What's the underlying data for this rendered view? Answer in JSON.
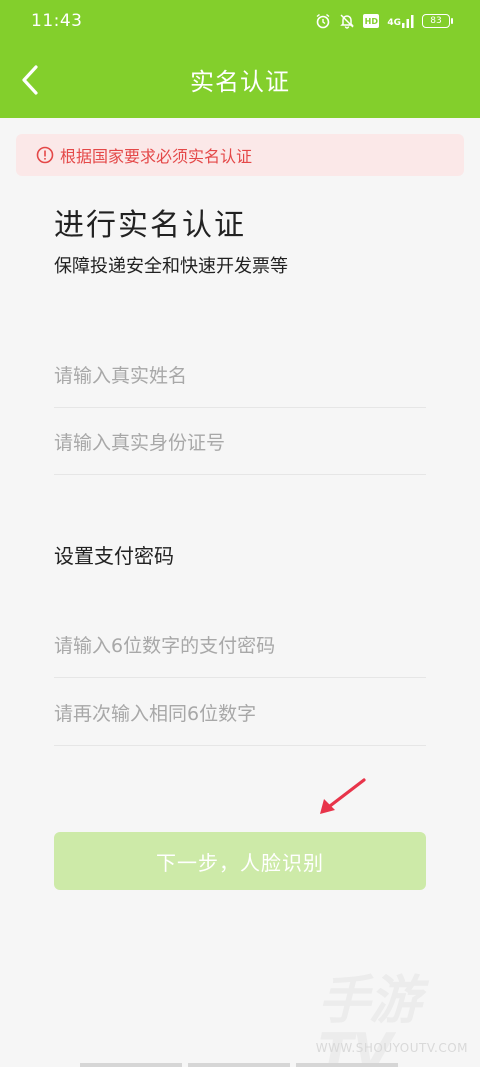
{
  "status_bar": {
    "time": "11:43",
    "hd_label": "HD",
    "network_label": "4G",
    "battery_level": "83"
  },
  "header": {
    "title": "实名认证",
    "background_color": "#83cf2c"
  },
  "notice": {
    "text": "根据国家要求必须实名认证",
    "color": "#e44848"
  },
  "content": {
    "title": "进行实名认证",
    "subtitle": "保障投递安全和快速开发票等"
  },
  "form": {
    "name_placeholder": "请输入真实姓名",
    "name_value": "",
    "id_placeholder": "请输入真实身份证号",
    "id_value": "",
    "payment_section_title": "设置支付密码",
    "password_placeholder": "请输入6位数字的支付密码",
    "password_value": "",
    "confirm_password_placeholder": "请再次输入相同6位数字",
    "confirm_password_value": ""
  },
  "actions": {
    "next_button_label": "下一步，人脸识别",
    "button_color": "#cdeaa8"
  },
  "watermark": {
    "logo": "手游TV",
    "url": "WWW.SHOUYOUTV.COM"
  },
  "icons": {
    "back": "chevron-left-icon",
    "alarm": "alarm-icon",
    "bell_off": "bell-off-icon",
    "notice": "exclamation-circle-icon",
    "annotation": "arrow-icon"
  }
}
